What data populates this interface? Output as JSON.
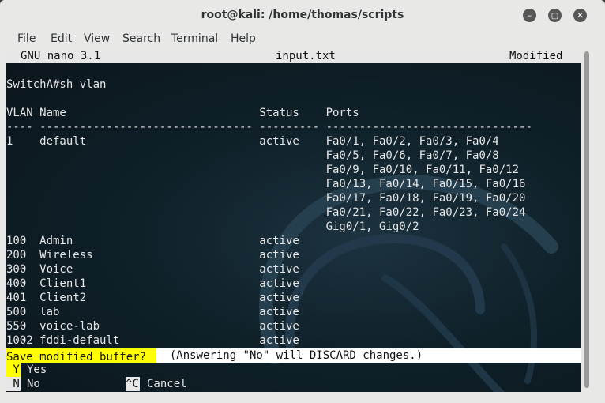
{
  "window": {
    "title": "root@kali: /home/thomas/scripts"
  },
  "menubar": [
    "File",
    "Edit",
    "View",
    "Search",
    "Terminal",
    "Help"
  ],
  "nano": {
    "version": "GNU nano 3.1",
    "filename": "input.txt",
    "status": "Modified"
  },
  "content": {
    "lines": [
      "",
      "SwitchA#sh vlan",
      "",
      "VLAN Name                             Status    Ports",
      "---- -------------------------------- --------- -------------------------------",
      "1    default                          active    Fa0/1, Fa0/2, Fa0/3, Fa0/4",
      "                                                Fa0/5, Fa0/6, Fa0/7, Fa0/8",
      "                                                Fa0/9, Fa0/10, Fa0/11, Fa0/12",
      "                                                Fa0/13, Fa0/14, Fa0/15, Fa0/16",
      "                                                Fa0/17, Fa0/18, Fa0/19, Fa0/20",
      "                                                Fa0/21, Fa0/22, Fa0/23, Fa0/24",
      "                                                Gig0/1, Gig0/2",
      "100  Admin                            active",
      "200  Wireless                         active",
      "300  Voice                            active",
      "400  Client1                          active",
      "401  Client2                          active",
      "500  lab                              active",
      "550  voice-lab                        active",
      "1002 fddi-default                     active"
    ]
  },
  "prompt": {
    "question": "Save modified buffer?",
    "note": "  (Answering \"No\" will DISCARD changes.)"
  },
  "options": {
    "yes_key": " Y",
    "yes_label": "Yes",
    "no_key": " N",
    "no_label": "No",
    "cancel_key": "^C",
    "cancel_label": "Cancel"
  },
  "colors": {
    "highlight": "#ffff00",
    "terminal_bg": "#0e1a20"
  }
}
